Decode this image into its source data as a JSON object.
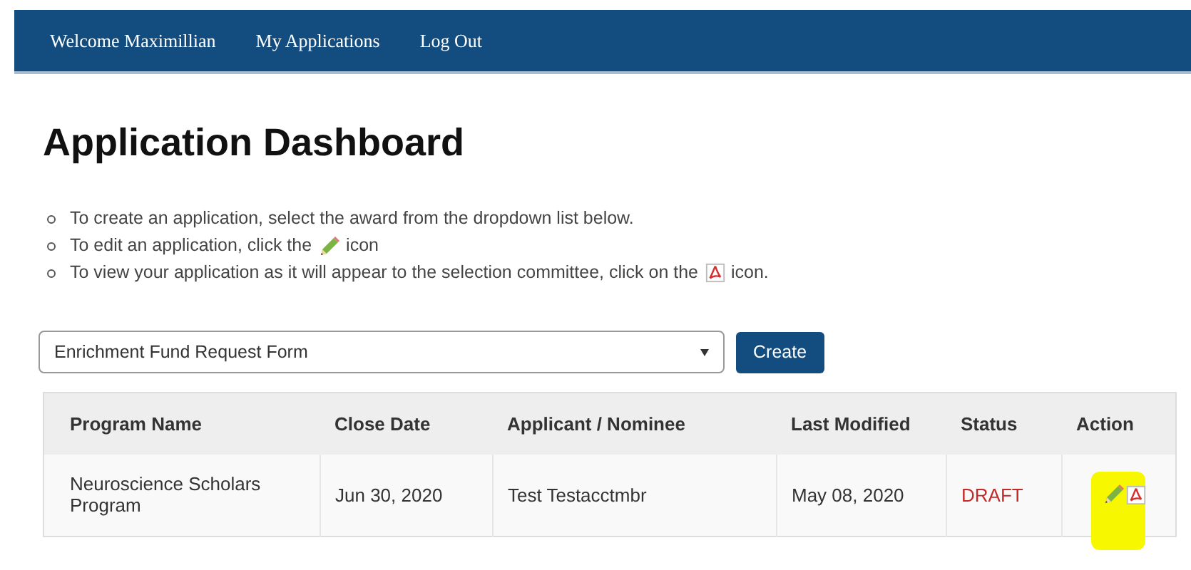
{
  "nav": {
    "items": [
      "Welcome Maximillian",
      "My Applications",
      "Log Out"
    ]
  },
  "title": "Application Dashboard",
  "instructions": [
    {
      "text": "To create an application, select the award from the dropdown list below."
    },
    {
      "text": "To edit an application, click the",
      "kind": "pencil",
      "after": "icon"
    },
    {
      "text": "To view your application as it will appear to the selection committee, click on the",
      "kind": "pdf",
      "after": "icon."
    }
  ],
  "award_select": {
    "value": "Enrichment Fund Request Form"
  },
  "create_button": "Create",
  "table": {
    "columns": [
      "Program Name",
      "Close Date",
      "Applicant / Nominee",
      "Last Modified",
      "Status",
      "Action"
    ],
    "rows": [
      {
        "program": "Neuroscience Scholars Program",
        "close_date": "Jun 30, 2020",
        "applicant": "Test Testacctmbr",
        "last_modified": "May 08, 2020",
        "status": "DRAFT",
        "highlighted": true
      }
    ]
  }
}
